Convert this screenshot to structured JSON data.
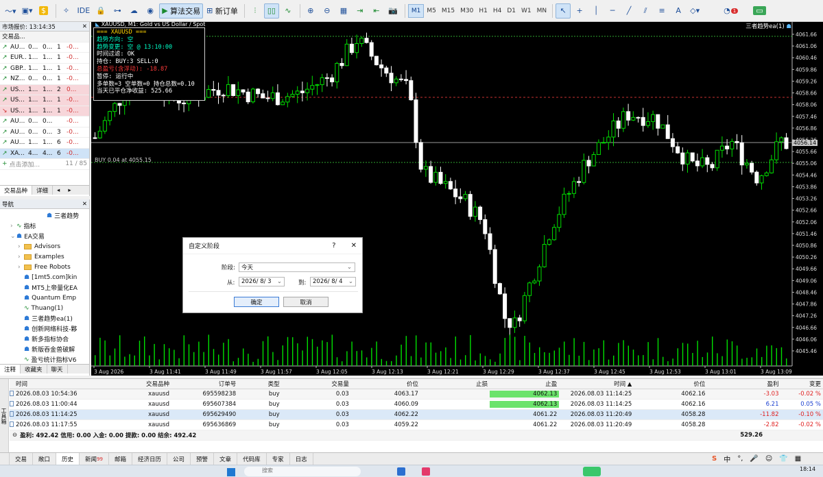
{
  "toolbar": {
    "ide_label": "IDE",
    "algo_label": "算法交易",
    "new_order_label": "新订单",
    "timeframes": [
      "M1",
      "M5",
      "M15",
      "M30",
      "H1",
      "H4",
      "D1",
      "W1",
      "MN"
    ],
    "active_timeframe": "M1",
    "notification_count": "1"
  },
  "market_watch": {
    "title": "市场报价: 13:14:35",
    "col_symbol": "交易品...",
    "rows": [
      {
        "arrow": "↗",
        "symbol": "AU...",
        "bid": "0...",
        "ask": "0...",
        "spread": "1",
        "change": "-0...",
        "dir": "up",
        "hl": "0"
      },
      {
        "arrow": "↗",
        "symbol": "EUR...",
        "bid": "1...",
        "ask": "1...",
        "spread": "1",
        "change": "-0...",
        "dir": "up",
        "hl": "0"
      },
      {
        "arrow": "↗",
        "symbol": "GBP...",
        "bid": "1...",
        "ask": "1...",
        "spread": "1",
        "change": "-0...",
        "dir": "up",
        "hl": "0"
      },
      {
        "arrow": "↗",
        "symbol": "NZ...",
        "bid": "0...",
        "ask": "0...",
        "spread": "1",
        "change": "-0...",
        "dir": "up",
        "hl": "0"
      },
      {
        "arrow": "↗",
        "symbol": "US...",
        "bid": "1...",
        "ask": "1...",
        "spread": "2",
        "change": "0...",
        "dir": "up",
        "hl": "1"
      },
      {
        "arrow": "↗",
        "symbol": "US...",
        "bid": "1...",
        "ask": "1...",
        "spread": "1",
        "change": "-0...",
        "dir": "up",
        "hl": "1"
      },
      {
        "arrow": "↘",
        "symbol": "US...",
        "bid": "1...",
        "ask": "1...",
        "spread": "1",
        "change": "-0...",
        "dir": "down",
        "hl": "1"
      },
      {
        "arrow": "↗",
        "symbol": "AU...",
        "bid": "0...",
        "ask": "0...",
        "spread": "",
        "change": "-0...",
        "dir": "up",
        "hl": "0"
      },
      {
        "arrow": "↗",
        "symbol": "AU...",
        "bid": "0...",
        "ask": "0...",
        "spread": "3",
        "change": "-0...",
        "dir": "up",
        "hl": "0"
      },
      {
        "arrow": "↗",
        "symbol": "AU...",
        "bid": "1...",
        "ask": "1...",
        "spread": "6",
        "change": "-0...",
        "dir": "up",
        "hl": "0"
      },
      {
        "arrow": "↗",
        "symbol": "XA...",
        "bid": "4...",
        "ask": "4...",
        "spread": "6",
        "change": "-0...",
        "dir": "up",
        "hl": "2"
      }
    ],
    "add_label": "点击添加...",
    "count": "11 / 85",
    "tabs": [
      "交易品种",
      "详细"
    ]
  },
  "navigator": {
    "title": "导航",
    "items": [
      {
        "label": "三者趋势",
        "indent": 5,
        "type": "ea"
      },
      {
        "label": "指标",
        "indent": 1,
        "type": "ind"
      },
      {
        "label": "EA交易",
        "indent": 1,
        "type": "ea"
      },
      {
        "label": "Advisors",
        "indent": 2,
        "type": "folder"
      },
      {
        "label": "Examples",
        "indent": 2,
        "type": "folder"
      },
      {
        "label": "Free Robots",
        "indent": 2,
        "type": "folder"
      },
      {
        "label": "[1mt5.com]kin",
        "indent": 2,
        "type": "ea"
      },
      {
        "label": "MT5上帝量化EA",
        "indent": 2,
        "type": "ea"
      },
      {
        "label": "Quantum Emp",
        "indent": 2,
        "type": "ea"
      },
      {
        "label": "Thuang(1)",
        "indent": 2,
        "type": "ind"
      },
      {
        "label": "三者趋势ea(1)",
        "indent": 2,
        "type": "ea"
      },
      {
        "label": "创新网络科技-夥",
        "indent": 2,
        "type": "ea"
      },
      {
        "label": "新多指标协合",
        "indent": 2,
        "type": "ea"
      },
      {
        "label": "新版吞金兽破解",
        "indent": 2,
        "type": "ea"
      },
      {
        "label": "盈亏统计指标V6",
        "indent": 2,
        "type": "ind"
      }
    ],
    "tabs": [
      "注释",
      "收藏夹",
      "聊天"
    ]
  },
  "chart": {
    "title": "XAUUSD, M1: Gold vs US Dollar / Spot",
    "ea_label": "三者趋势ea(1)",
    "order_line_label": "BUY 0.04 at 4055.15",
    "price_badge": "4056.14",
    "price_ticks": [
      "4061.66",
      "4061.06",
      "4060.46",
      "4059.86",
      "4059.26",
      "4058.66",
      "4058.06",
      "4057.46",
      "4056.86",
      "4056.26",
      "4055.66",
      "4055.06",
      "4054.46",
      "4053.86",
      "4053.26",
      "4052.66",
      "4052.06",
      "4051.46",
      "4050.86",
      "4050.26",
      "4049.66",
      "4049.06",
      "4048.46",
      "4047.86",
      "4047.26",
      "4046.66",
      "4046.06",
      "4045.46"
    ],
    "time_ticks": [
      "3 Aug 2026",
      "3 Aug 11:41",
      "3 Aug 11:49",
      "3 Aug 11:57",
      "3 Aug 12:05",
      "3 Aug 12:13",
      "3 Aug 12:21",
      "3 Aug 12:29",
      "3 Aug 12:37",
      "3 Aug 12:45",
      "3 Aug 12:53",
      "3 Aug 13:01",
      "3 Aug 13:09"
    ]
  },
  "hud": {
    "line1": "=== XAUUSD ===",
    "line2": "趋势方向: 空",
    "line3": "趋势变更: 空 @ 13:10:00",
    "line4": "时间过滤: OK",
    "line5": "持仓: BUY:3   SELL:0",
    "line6": "总盈亏(含浮动): -18.87",
    "line7": "暂停: 运行中",
    "line8": "多单数=3 空单数=0 持仓总数=0.10",
    "line9": "当天已平仓净收益: 525.66"
  },
  "dialog": {
    "title": "自定义阶段",
    "help": "?",
    "close": "✕",
    "period_label": "阶段:",
    "period_value": "今天",
    "from_label": "从:",
    "from_value": "2026/ 8/ 3",
    "to_label": "到:",
    "to_value": "2026/ 8/ 4",
    "ok": "确定",
    "cancel": "取消"
  },
  "terminal": {
    "headers": [
      "时间",
      "交易品种",
      "订单号",
      "类型",
      "交易量",
      "价位",
      "止损",
      "止盈",
      "时间 ▲",
      "价位",
      "盈利",
      "变更"
    ],
    "rows": [
      {
        "time": "2026.08.03 10:54:36",
        "symbol": "xauusd",
        "order": "695598238",
        "type": "buy",
        "volume": "0.03",
        "price": "4063.17",
        "sl": "",
        "tp": "4062.13",
        "close_time": "2026.08.03 11:14:25",
        "close_price": "4062.16",
        "profit": "-3.03",
        "change": "-0.02 %",
        "tp_hl": true,
        "pos": false,
        "sel": false
      },
      {
        "time": "2026.08.03 11:00:44",
        "symbol": "xauusd",
        "order": "695607384",
        "type": "buy",
        "volume": "0.03",
        "price": "4060.09",
        "sl": "",
        "tp": "4062.13",
        "close_time": "2026.08.03 11:14:25",
        "close_price": "4062.16",
        "profit": "6.21",
        "change": "0.05 %",
        "tp_hl": true,
        "pos": true,
        "sel": false
      },
      {
        "time": "2026.08.03 11:14:25",
        "symbol": "xauusd",
        "order": "695629490",
        "type": "buy",
        "volume": "0.03",
        "price": "4062.22",
        "sl": "",
        "tp": "4061.22",
        "close_time": "2026.08.03 11:20:49",
        "close_price": "4058.28",
        "profit": "-11.82",
        "change": "-0.10 %",
        "tp_hl": false,
        "pos": false,
        "sel": true
      },
      {
        "time": "2026.08.03 11:17:55",
        "symbol": "xauusd",
        "order": "695636869",
        "type": "buy",
        "volume": "0.03",
        "price": "4059.22",
        "sl": "",
        "tp": "4061.22",
        "close_time": "2026.08.03 11:20:49",
        "close_price": "4058.28",
        "profit": "-2.82",
        "change": "-0.02 %",
        "tp_hl": false,
        "pos": false,
        "sel": false
      }
    ],
    "summary": "盈利: 492.42  信用: 0.00  入金: 0.00  提款: 0.00  结余: 492.42",
    "total": "529.26",
    "side_label": "工具箱",
    "tabs": [
      {
        "label": "交易",
        "badge": ""
      },
      {
        "label": "敞口",
        "badge": ""
      },
      {
        "label": "历史",
        "badge": ""
      },
      {
        "label": "新闻",
        "badge": "99"
      },
      {
        "label": "邮箱",
        "badge": ""
      },
      {
        "label": "经济日历",
        "badge": ""
      },
      {
        "label": "公司",
        "badge": ""
      },
      {
        "label": "预警",
        "badge": ""
      },
      {
        "label": "文章",
        "badge": ""
      },
      {
        "label": "代码库",
        "badge": ""
      },
      {
        "label": "专家",
        "badge": ""
      },
      {
        "label": "日志",
        "badge": ""
      }
    ],
    "active_tab": "历史"
  },
  "tray": {
    "ime": "中",
    "clock": "18:14"
  },
  "taskbar": {
    "search_placeholder": "搜索"
  },
  "colors": {
    "bull": "#00e000",
    "bear": "#ffffff",
    "accent": "#1e4f9a",
    "loss": "#e02020",
    "profit": "#1a3fd0",
    "tp_fill": "#6be36b"
  }
}
